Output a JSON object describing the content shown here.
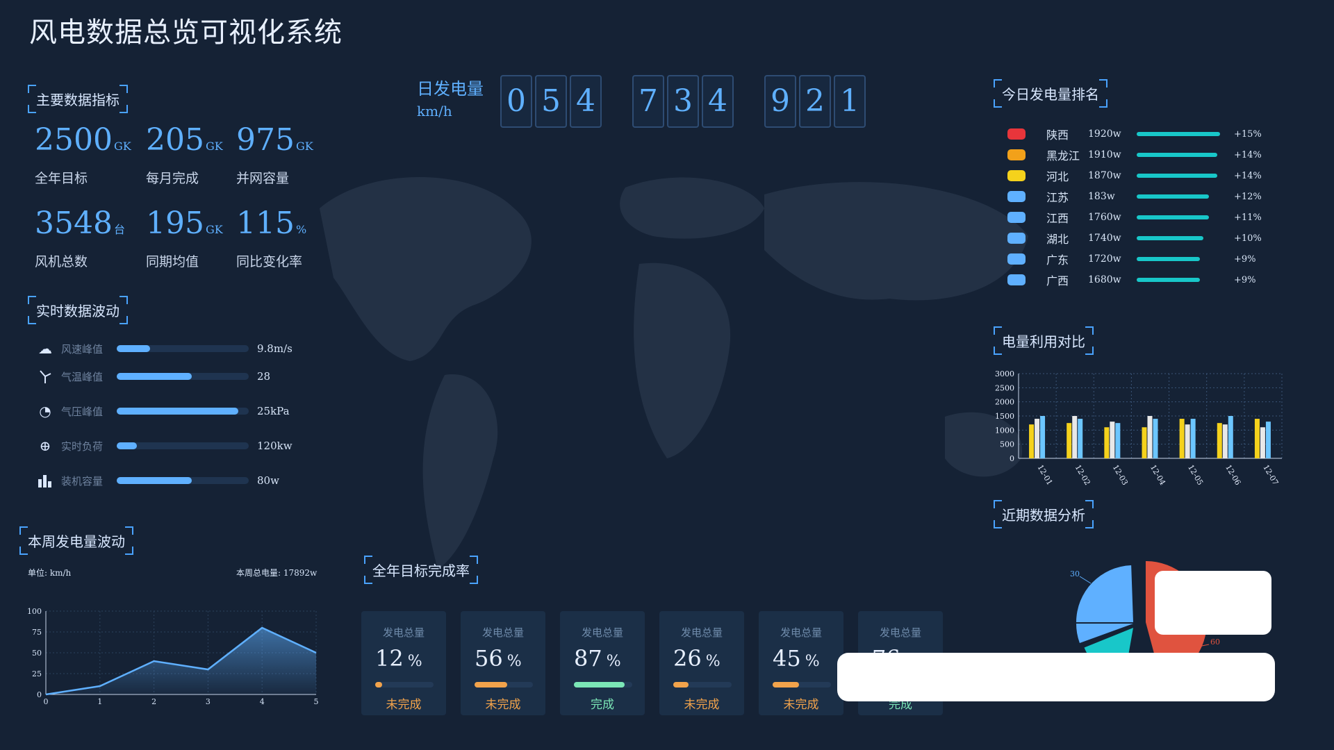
{
  "title": "风电数据总览可视化系统",
  "sections": {
    "main_metrics": "主要数据指标",
    "realtime": "实时数据波动",
    "weekly": "本周发电量波动",
    "annual_rate": "全年目标完成率",
    "ranking": "今日发电量排名",
    "utilization": "电量利用对比",
    "recent": "近期数据分析"
  },
  "metrics": [
    {
      "value": "2500",
      "unit": "GK",
      "label": "全年目标"
    },
    {
      "value": "205",
      "unit": "GK",
      "label": "每月完成"
    },
    {
      "value": "975",
      "unit": "GK",
      "label": "并网容量"
    },
    {
      "value": "3548",
      "unit": "台",
      "label": "风机总数"
    },
    {
      "value": "195",
      "unit": "GK",
      "label": "同期均值"
    },
    {
      "value": "115",
      "unit": "%",
      "label": "同比变化率"
    }
  ],
  "realtime": [
    {
      "icon": "cloud-icon",
      "label": "风速峰值",
      "value": "9.8m/s",
      "level": 0.25
    },
    {
      "icon": "turbine-icon",
      "label": "气温峰值",
      "value": "28",
      "level": 0.57
    },
    {
      "icon": "gauge-clock-icon",
      "label": "气压峰值",
      "value": "25kPa",
      "level": 0.92
    },
    {
      "icon": "globe-icon",
      "label": "实时负荷",
      "value": "120kw",
      "level": 0.15
    },
    {
      "icon": "bar-chart-icon",
      "label": "装机容量",
      "value": "80w",
      "level": 0.57
    }
  ],
  "daily": {
    "label": "日发电量",
    "unit": "km/h",
    "digits": [
      "0",
      "5",
      "4",
      "7",
      "3",
      "4",
      "9",
      "2",
      "1"
    ]
  },
  "ranking": [
    {
      "province": "陕西",
      "value": "1920w",
      "pct": "+15%",
      "color": "#e8353b",
      "level": 1.0
    },
    {
      "province": "黑龙江",
      "value": "1910w",
      "pct": "+14%",
      "color": "#f2a11a",
      "level": 0.97
    },
    {
      "province": "河北",
      "value": "1870w",
      "pct": "+14%",
      "color": "#f5d21c",
      "level": 0.97
    },
    {
      "province": "江苏",
      "value": "183w",
      "pct": "+12%",
      "color": "#5fb0ff",
      "level": 0.87
    },
    {
      "province": "江西",
      "value": "1760w",
      "pct": "+11%",
      "color": "#5fb0ff",
      "level": 0.87
    },
    {
      "province": "湖北",
      "value": "1740w",
      "pct": "+10%",
      "color": "#5fb0ff",
      "level": 0.8
    },
    {
      "province": "广东",
      "value": "1720w",
      "pct": "+9%",
      "color": "#5fb0ff",
      "level": 0.76
    },
    {
      "province": "广西",
      "value": "1680w",
      "pct": "+9%",
      "color": "#5fb0ff",
      "level": 0.76
    }
  ],
  "weekly_meta": {
    "unit_label": "单位: km/h",
    "total_label": "本周总电量: 17892w"
  },
  "completion_cards": [
    {
      "label": "发电总量",
      "value": "12",
      "pct_sign": "%",
      "status": "未完成",
      "level": 0.12,
      "color": "#f2a34b"
    },
    {
      "label": "发电总量",
      "value": "56",
      "pct_sign": "%",
      "status": "未完成",
      "level": 0.56,
      "color": "#f2a34b"
    },
    {
      "label": "发电总量",
      "value": "87",
      "pct_sign": "%",
      "status": "完成",
      "level": 0.87,
      "color": "#7be6b6"
    },
    {
      "label": "发电总量",
      "value": "26",
      "pct_sign": "%",
      "status": "未完成",
      "level": 0.26,
      "color": "#f2a34b"
    },
    {
      "label": "发电总量",
      "value": "45",
      "pct_sign": "%",
      "status": "未完成",
      "level": 0.45,
      "color": "#f2a34b"
    },
    {
      "label": "发电总量",
      "value": "76",
      "pct_sign": "%",
      "status": "完成",
      "level": 0.76,
      "color": "#7be6b6"
    }
  ],
  "colors": {
    "accent": "#5fb0ff",
    "teal": "#18c7c9",
    "orange": "#f2a34b",
    "green": "#7be6b6"
  },
  "chart_data": [
    {
      "type": "area",
      "x": [
        0,
        1,
        2,
        3,
        4,
        5
      ],
      "series": [
        {
          "values": [
            0,
            10,
            40,
            30,
            80,
            50
          ]
        }
      ],
      "ylim": [
        0,
        100
      ],
      "yticks": [
        0,
        25,
        50,
        75,
        100
      ],
      "grid": true
    },
    {
      "type": "bar",
      "categories": [
        "12-01",
        "12-02",
        "12-03",
        "12-04",
        "12-05",
        "12-06",
        "12-07"
      ],
      "series": [
        {
          "values": [
            1200,
            1250,
            1100,
            1100,
            1400,
            1250,
            1400
          ]
        },
        {
          "values": [
            1400,
            1500,
            1300,
            1500,
            1200,
            1200,
            1100
          ]
        },
        {
          "values": [
            1500,
            1400,
            1250,
            1400,
            1400,
            1500,
            1300
          ]
        }
      ],
      "colors": [
        "#f5d21c",
        "#e8e8e8",
        "#6cc6ff"
      ],
      "ylim": [
        0,
        3000
      ],
      "yticks": [
        0,
        500,
        1000,
        1500,
        2000,
        2500,
        3000
      ],
      "grid": true
    },
    {
      "type": "pie",
      "visible_labels": [
        "30",
        "60"
      ],
      "slices": [
        {
          "label": "30",
          "color": "#5fb0ff"
        },
        {
          "label": "60",
          "color": "#e0533f"
        },
        {
          "color": "#18c7c9"
        }
      ]
    }
  ]
}
